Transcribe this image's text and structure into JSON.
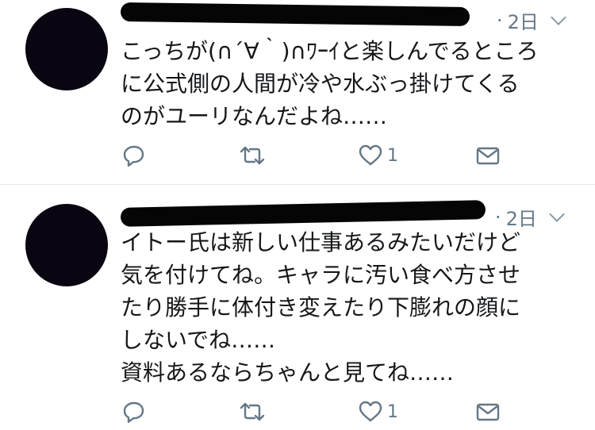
{
  "tweets": [
    {
      "timestamp": "2日",
      "text": "こっちが(∩´∀｀)∩ﾜｰｲと楽しんでるところ\nに公式側の人間が冷や水ぶっ掛けてくる\nのがユーリなんだよね……",
      "like_count": "1"
    },
    {
      "timestamp": "2日",
      "text": "イトー氏は新しい仕事あるみたいだけど\n気を付けてね。キャラに汚い食べ方させ\nたり勝手に体付き変えたり下膨れの顔に\nしないでね……\n資料あるならちゃんと見てね……",
      "like_count": "1"
    }
  ],
  "icons": {
    "reply": "reply-icon",
    "retweet": "retweet-icon",
    "like": "heart-icon",
    "message": "envelope-icon",
    "more": "chevron-down-icon"
  },
  "colors": {
    "text": "#14171a",
    "muted": "#657786",
    "divider": "#e1e8ed",
    "redaction": "#050505"
  }
}
